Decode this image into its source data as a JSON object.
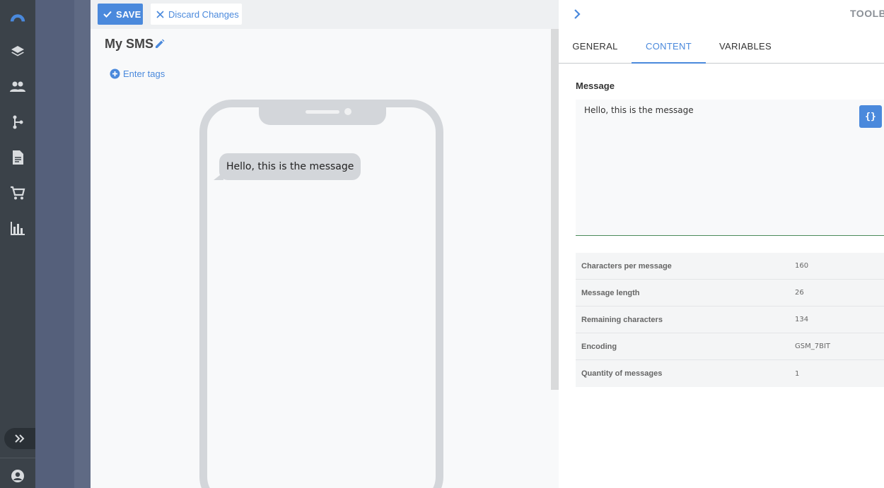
{
  "toolbar": {
    "save_label": "SAVE",
    "discard_label": "Discard Changes"
  },
  "editor": {
    "title": "My SMS",
    "tags_label": "Enter tags"
  },
  "preview": {
    "bubble_text": "Hello, this is the message"
  },
  "toolbox": {
    "title": "TOOLB",
    "tabs": [
      {
        "label": "GENERAL",
        "active": false
      },
      {
        "label": "CONTENT",
        "active": true
      },
      {
        "label": "VARIABLES",
        "active": false
      }
    ],
    "message_label": "Message",
    "message_value": "Hello, this is the message",
    "variables_button": "{}",
    "stats": [
      {
        "label": "Characters per message",
        "value": "160"
      },
      {
        "label": "Message length",
        "value": "26"
      },
      {
        "label": "Remaining characters",
        "value": "134"
      },
      {
        "label": "Encoding",
        "value": "GSM_7BIT"
      },
      {
        "label": "Quantity of messages",
        "value": "1"
      }
    ]
  },
  "sidebar": {
    "icons": [
      "logo-icon",
      "layers-icon",
      "contacts-icon",
      "flow-icon",
      "document-icon",
      "cart-icon",
      "analytics-icon",
      "expand-icon",
      "account-icon"
    ]
  },
  "colors": {
    "accent": "#4a89dc",
    "rail": "#3b4249",
    "backdrop": "#55607b"
  }
}
